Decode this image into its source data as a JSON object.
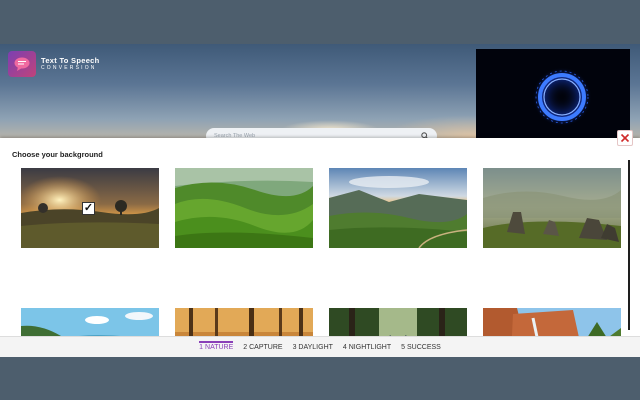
{
  "app": {
    "logo_title": "Text To Speech",
    "logo_subtitle": "CONVERSION",
    "search_placeholder": "Search The Web"
  },
  "modal": {
    "title": "Choose your background",
    "selected_index": 0
  },
  "thumbnails": [
    {
      "name": "sunset-meadow",
      "selected": true
    },
    {
      "name": "green-hills",
      "selected": false
    },
    {
      "name": "mountain-valley",
      "selected": false
    },
    {
      "name": "misty-rocks",
      "selected": false
    },
    {
      "name": "coastal-bay",
      "selected": false
    },
    {
      "name": "autumn-forest",
      "selected": false
    },
    {
      "name": "forest-bridge",
      "selected": false
    },
    {
      "name": "red-cliffs-waterfall",
      "selected": false
    }
  ],
  "wizard": {
    "steps": [
      "1 NATURE",
      "2 CAPTURE",
      "3 DAYLIGHT",
      "4 NIGHTLIGHT",
      "5 SUCCESS"
    ],
    "active_step": 1
  },
  "colors": {
    "accent": "#8a3fb8",
    "close": "#d02a2a",
    "voice_ring": "#2f6cff"
  },
  "icons": {
    "close": "close-icon",
    "search": "search-icon",
    "check": "checkbox-checked-icon"
  }
}
